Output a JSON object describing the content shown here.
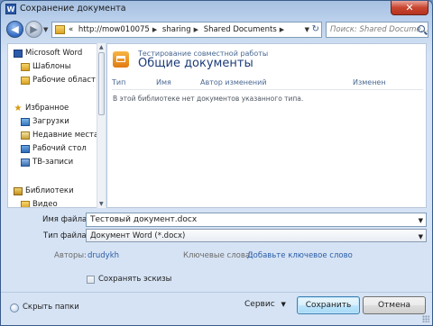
{
  "window": {
    "title": "Сохранение документа",
    "app_icon_letter": "W",
    "close_label": "✕"
  },
  "nav": {
    "back_label": "◀",
    "forward_label": "▶",
    "breadcrumbs": [
      "«",
      "http://mow010075",
      "sharing",
      "Shared Documents"
    ],
    "search_placeholder": "Поиск: Shared Docume...",
    "refresh_label": "↻"
  },
  "sidebar": {
    "items": [
      {
        "label": "Microsoft Word",
        "icon": "word-icon"
      },
      {
        "label": "Шаблоны",
        "icon": "folder-icon"
      },
      {
        "label": "Рабочие област",
        "icon": "folder-icon"
      },
      {
        "label": "Избранное",
        "icon": "star-icon"
      },
      {
        "label": "Загрузки",
        "icon": "downloads-icon"
      },
      {
        "label": "Недавние места",
        "icon": "recent-places-icon"
      },
      {
        "label": "Рабочий стол",
        "icon": "desktop-icon"
      },
      {
        "label": "ТВ-записи",
        "icon": "tv-recordings-icon"
      },
      {
        "label": "Библиотеки",
        "icon": "libraries-icon"
      },
      {
        "label": "Видео",
        "icon": "video-icon"
      }
    ]
  },
  "main": {
    "subtitle": "Тестирование совместной работы",
    "title": "Общие документы",
    "columns": [
      "Тип",
      "Имя",
      "Автор изменений",
      "Изменен"
    ],
    "empty_message": "В этой библиотеке нет документов указанного типа."
  },
  "form": {
    "filename_label": "Имя файла:",
    "filename_value": "Тестовый документ.docx",
    "filetype_label": "Тип файла:",
    "filetype_value": "Документ Word (*.docx)",
    "authors_label": "Авторы:",
    "authors_value": "drudykh",
    "keywords_label": "Ключевые слова:",
    "keywords_value": "Добавьте ключевое слово",
    "thumbnails_label": "Сохранять эскизы",
    "thumbnails_checked": false
  },
  "footer": {
    "hide_folders_label": "Скрыть папки",
    "service_label": "Сервис",
    "save_label": "Сохранить",
    "cancel_label": "Отмена"
  },
  "colors": {
    "accent": "#2a5da6",
    "title_blue": "#1c3c78",
    "close_red": "#c8452f"
  }
}
